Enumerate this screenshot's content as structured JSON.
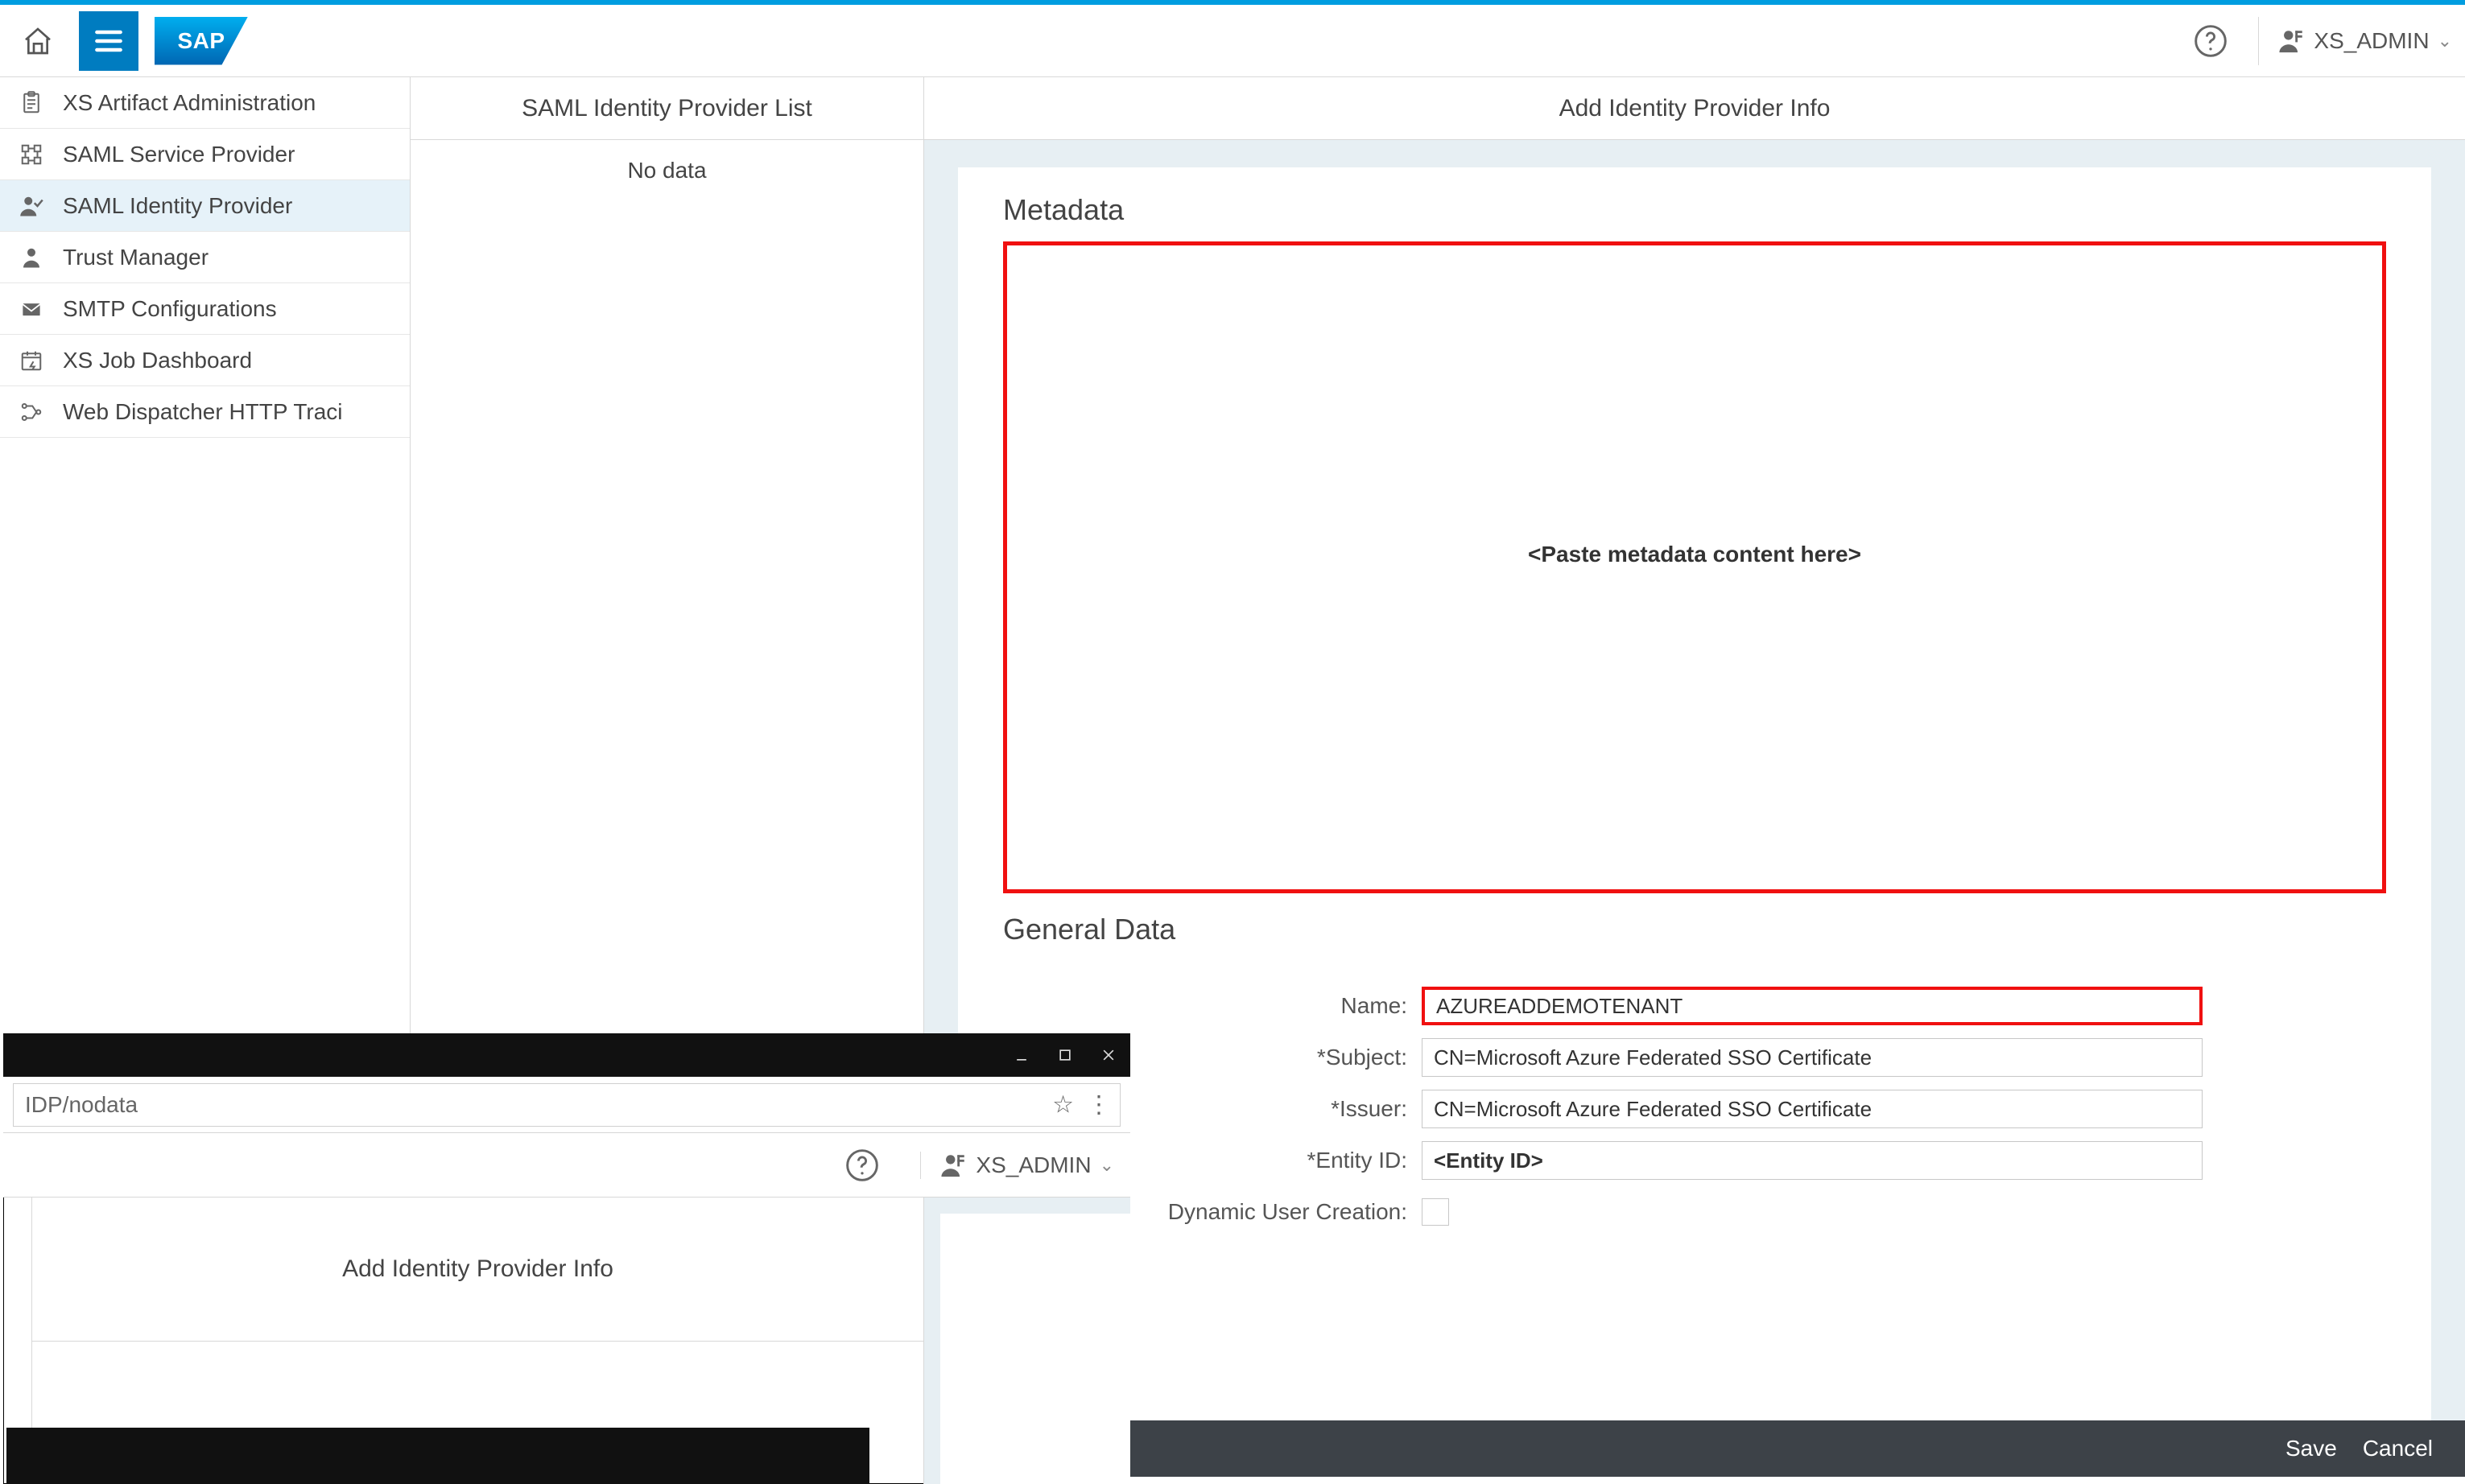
{
  "header": {
    "sap_logo_text": "SAP",
    "user_label": "XS_ADMIN"
  },
  "sidebar": {
    "items": [
      {
        "label": "XS Artifact Administration",
        "icon": "clipboard-icon",
        "active": false
      },
      {
        "label": "SAML Service Provider",
        "icon": "grid-icon",
        "active": false
      },
      {
        "label": "SAML Identity Provider",
        "icon": "person-check-icon",
        "active": true
      },
      {
        "label": "Trust Manager",
        "icon": "person-icon",
        "active": false
      },
      {
        "label": "SMTP Configurations",
        "icon": "mail-icon",
        "active": false
      },
      {
        "label": "XS Job Dashboard",
        "icon": "calendar-icon",
        "active": false
      },
      {
        "label": "Web Dispatcher HTTP Traci",
        "icon": "nodes-icon",
        "active": false
      }
    ]
  },
  "list": {
    "title": "SAML Identity Provider List",
    "empty_text": "No data"
  },
  "main": {
    "title": "Add Identity Provider Info",
    "metadata_section": "Metadata",
    "metadata_placeholder": "<Paste metadata content here>",
    "general_section": "General Data",
    "fields": {
      "name_label": "Name:",
      "name_value": "AZUREADDEMOTENANT",
      "subject_label": "*Subject:",
      "subject_value": "CN=Microsoft Azure Federated SSO Certificate",
      "issuer_label": "*Issuer:",
      "issuer_value": "CN=Microsoft Azure Federated SSO Certificate",
      "entity_label": "*Entity ID:",
      "entity_value": "<Entity ID>",
      "dynamic_label": "Dynamic User Creation:"
    },
    "footer": {
      "save": "Save",
      "cancel": "Cancel"
    }
  },
  "overlay": {
    "url_value": "IDP/nodata",
    "user_label": "XS_ADMIN",
    "title": "Add Identity Provider Info"
  }
}
